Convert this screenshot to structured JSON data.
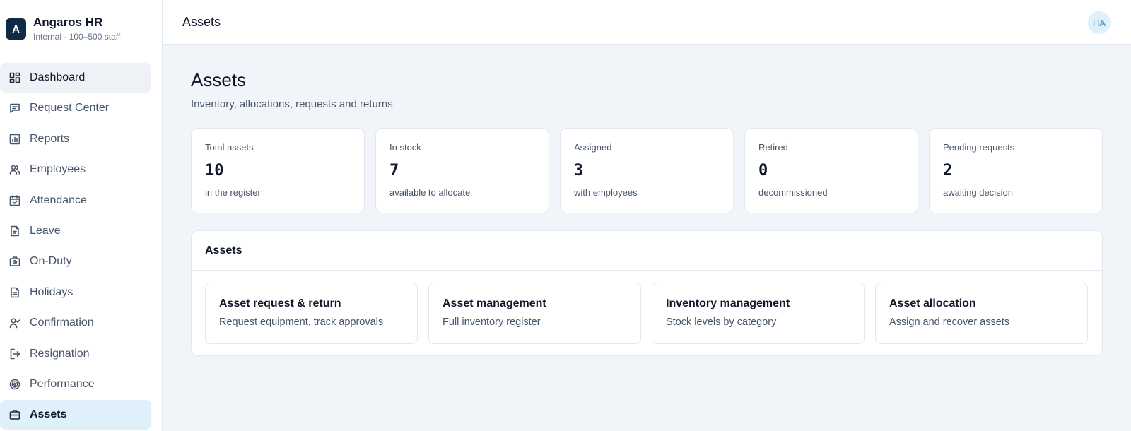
{
  "brand": {
    "logo_letter": "A",
    "name": "Angaros HR",
    "subtitle": "Internal · 100–500 staff"
  },
  "sidebar": {
    "items": [
      {
        "label": "Dashboard",
        "icon": "grid-icon"
      },
      {
        "label": "Request Center",
        "icon": "message-square-icon"
      },
      {
        "label": "Reports",
        "icon": "bar-chart-icon"
      },
      {
        "label": "Employees",
        "icon": "users-icon"
      },
      {
        "label": "Attendance",
        "icon": "calendar-check-icon"
      },
      {
        "label": "Leave",
        "icon": "file-icon"
      },
      {
        "label": "On-Duty",
        "icon": "briefcase-clock-icon"
      },
      {
        "label": "Holidays",
        "icon": "file-text-icon"
      },
      {
        "label": "Confirmation",
        "icon": "user-check-icon"
      },
      {
        "label": "Resignation",
        "icon": "log-out-icon"
      },
      {
        "label": "Performance",
        "icon": "target-icon"
      },
      {
        "label": "Assets",
        "icon": "briefcase-icon"
      }
    ]
  },
  "header": {
    "title": "Assets",
    "avatar_initials": "HA"
  },
  "main": {
    "title": "Assets",
    "subtitle": "Inventory, allocations, requests and returns",
    "stats": [
      {
        "label": "Total assets",
        "value": "10",
        "note": "in the register"
      },
      {
        "label": "In stock",
        "value": "7",
        "note": "available to allocate"
      },
      {
        "label": "Assigned",
        "value": "3",
        "note": "with employees"
      },
      {
        "label": "Retired",
        "value": "0",
        "note": "decommissioned"
      },
      {
        "label": "Pending requests",
        "value": "2",
        "note": "awaiting decision"
      }
    ],
    "panel": {
      "title": "Assets",
      "tiles": [
        {
          "title": "Asset request & return",
          "desc": "Request equipment, track approvals"
        },
        {
          "title": "Asset management",
          "desc": "Full inventory register"
        },
        {
          "title": "Inventory management",
          "desc": "Stock levels by category"
        },
        {
          "title": "Asset allocation",
          "desc": "Assign and recover assets"
        }
      ]
    }
  },
  "colors": {
    "accent": "#2a89c3",
    "active_bg": "#e0f0fa",
    "brand_logo": "#0f2a44"
  }
}
